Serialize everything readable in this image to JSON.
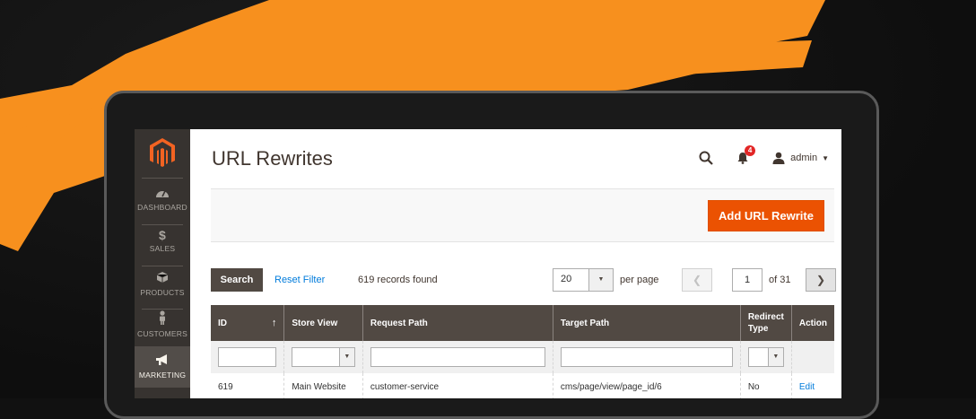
{
  "page": {
    "title": "URL Rewrites"
  },
  "header": {
    "notifications_count": "4",
    "user_name": "admin"
  },
  "sidebar": {
    "items": [
      {
        "label": "DASHBOARD",
        "icon": "dashboard-icon"
      },
      {
        "label": "SALES",
        "icon": "dollar-icon"
      },
      {
        "label": "PRODUCTS",
        "icon": "cube-icon"
      },
      {
        "label": "CUSTOMERS",
        "icon": "person-icon"
      },
      {
        "label": "MARKETING",
        "icon": "megaphone-icon"
      }
    ]
  },
  "actions": {
    "add_button": "Add URL Rewrite"
  },
  "toolbar": {
    "search_label": "Search",
    "reset_label": "Reset Filter",
    "records": "619 records found",
    "per_page_value": "20",
    "per_page_label": "per page",
    "page_current": "1",
    "page_of": "of 31"
  },
  "table": {
    "columns": [
      "ID",
      "Store View",
      "Request Path",
      "Target Path",
      "Redirect Type",
      "Action"
    ],
    "rows": [
      {
        "id": "619",
        "store_view": "Main Website",
        "request_path": "customer-service",
        "target_path": "cms/page/view/page_id/6",
        "redirect_type": "No",
        "action": "Edit"
      }
    ]
  },
  "colors": {
    "accent": "#eb5202",
    "sidebar": "#373330",
    "header": "#514943",
    "link": "#007bdb"
  }
}
